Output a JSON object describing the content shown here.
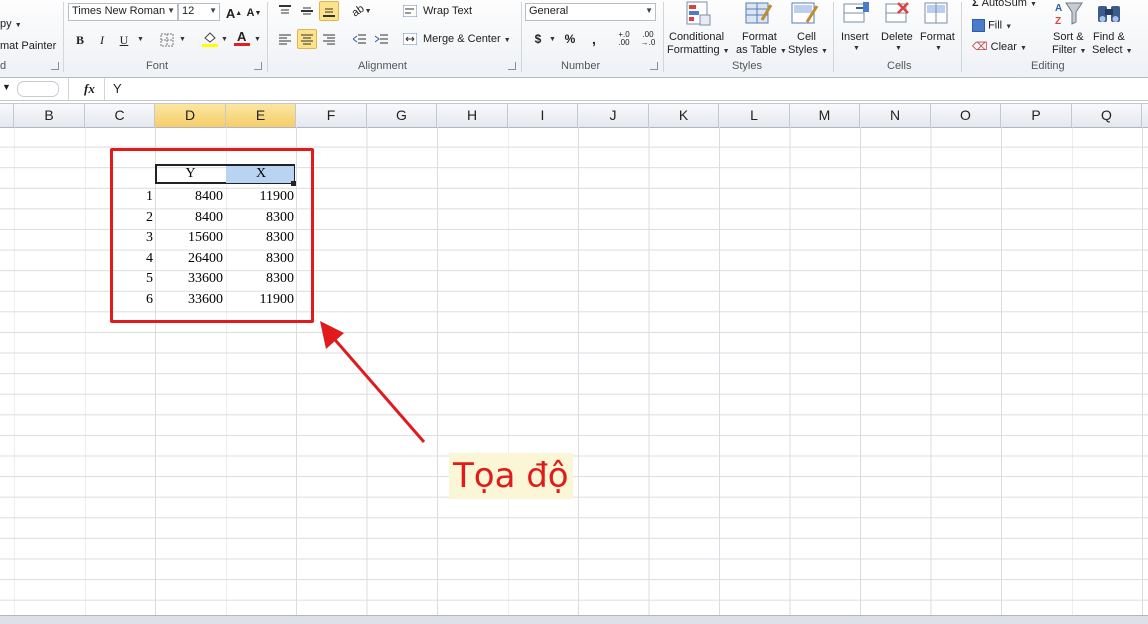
{
  "ribbon": {
    "clipboard": {
      "copy": "py",
      "format_painter": "mat Painter",
      "label": "d"
    },
    "font": {
      "name": "Times New Roman",
      "size": "12",
      "bold": "B",
      "italic": "I",
      "underline": "U",
      "grow": "A",
      "shrink": "A",
      "label": "Font"
    },
    "alignment": {
      "wrap_text": "Wrap Text",
      "merge_center": "Merge & Center",
      "label": "Alignment"
    },
    "number": {
      "format": "General",
      "currency": "$",
      "percent": "%",
      "comma": ",",
      "label": "Number"
    },
    "styles": {
      "conditional_1": "Conditional",
      "conditional_2": "Formatting",
      "format_table_1": "Format",
      "format_table_2": "as Table",
      "cell_styles_1": "Cell",
      "cell_styles_2": "Styles",
      "label": "Styles"
    },
    "cells": {
      "insert": "Insert",
      "delete": "Delete",
      "format": "Format",
      "label": "Cells"
    },
    "editing": {
      "autosum": "AutoSum",
      "fill": "Fill",
      "clear": "Clear",
      "sort_1": "Sort &",
      "sort_2": "Filter",
      "find_1": "Find &",
      "find_2": "Select",
      "label": "Editing"
    }
  },
  "formula_bar": {
    "fx": "fx",
    "value": "Y"
  },
  "columns": [
    "B",
    "C",
    "D",
    "E",
    "F",
    "G",
    "H",
    "I",
    "J",
    "K",
    "L",
    "M",
    "N",
    "O",
    "P",
    "Q"
  ],
  "table": {
    "headers": [
      "Y",
      "X"
    ],
    "rows": [
      {
        "idx": "1",
        "y": "8400",
        "x": "11900"
      },
      {
        "idx": "2",
        "y": "8400",
        "x": "8300"
      },
      {
        "idx": "3",
        "y": "15600",
        "x": "8300"
      },
      {
        "idx": "4",
        "y": "26400",
        "x": "8300"
      },
      {
        "idx": "5",
        "y": "33600",
        "x": "8300"
      },
      {
        "idx": "6",
        "y": "33600",
        "x": "11900"
      }
    ]
  },
  "annotation": {
    "label": "Tọa độ",
    "color": "#e11b1b",
    "background": "#fbf6d5"
  },
  "colors": {
    "selected_header": "#f5cd6a",
    "selected_cell": "#b9d3f3"
  }
}
